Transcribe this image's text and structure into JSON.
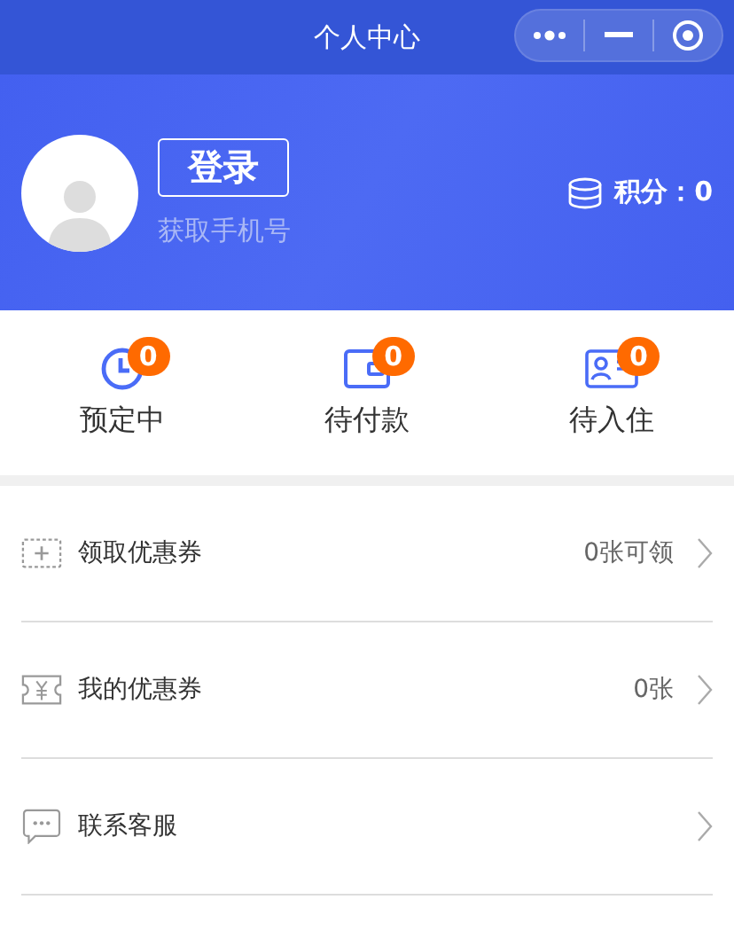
{
  "nav_bar": {
    "title": "个人中心"
  },
  "profile": {
    "login_button": "登录",
    "phone_link": "获取手机号",
    "points": "积分：0"
  },
  "orders": [
    {
      "kind": "clock",
      "label": "预定中",
      "count": "0"
    },
    {
      "kind": "wallet",
      "label": "待付款",
      "count": "0"
    },
    {
      "kind": "card",
      "label": "待入住",
      "count": "0"
    }
  ],
  "menu": [
    {
      "kind": "coupon-add",
      "label": "领取优惠券",
      "value": "0张可领"
    },
    {
      "kind": "coupon-yen",
      "label": "我的优惠券",
      "value": "0张"
    },
    {
      "kind": "chat",
      "label": "联系客服"
    }
  ]
}
